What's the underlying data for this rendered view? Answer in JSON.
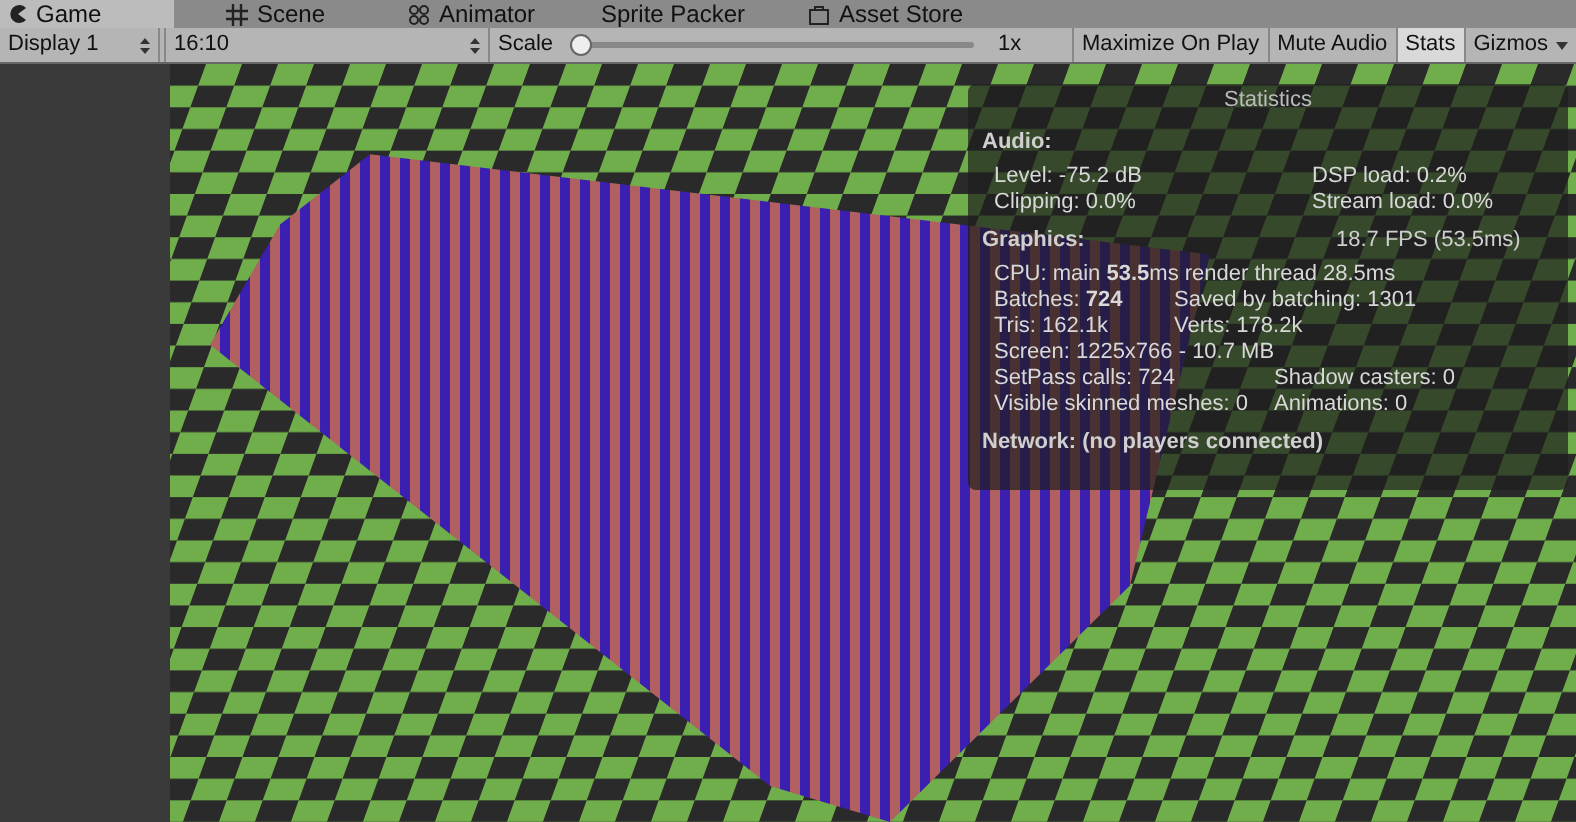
{
  "tabs": [
    {
      "label": "Game",
      "selected": true
    },
    {
      "label": "Scene",
      "selected": false
    },
    {
      "label": "Animator",
      "selected": false
    },
    {
      "label": "Sprite Packer",
      "selected": false
    },
    {
      "label": "Asset Store",
      "selected": false
    }
  ],
  "toolbar": {
    "display": "Display 1",
    "aspect": "16:10",
    "scale": {
      "label": "Scale",
      "level": 0,
      "reading": "1x"
    },
    "buttons": [
      {
        "kind": "toggle",
        "label": "Maximize On Play",
        "on": false
      },
      {
        "kind": "toggle",
        "label": "Mute Audio",
        "on": false
      },
      {
        "kind": "toggle",
        "label": "Stats",
        "on": true
      },
      {
        "kind": "dropdown",
        "label": "Gizmos"
      }
    ]
  },
  "statistics": {
    "title": "Statistics",
    "sections": [
      {
        "heading": "Audio:",
        "rows": [
          {
            "kind": "split",
            "left": "Level: -75.2 dB",
            "right": "DSP load: 0.2%"
          },
          {
            "kind": "split",
            "left": "Clipping: 0.0%",
            "right": "Stream load: 0.0%"
          }
        ]
      },
      {
        "heading": "Graphics:",
        "heading_right": "18.7 FPS (53.5ms)",
        "rows": [
          {
            "kind": "single",
            "left": "CPU: main **53.5**ms  render thread 28.5ms"
          },
          {
            "kind": "short",
            "left": "Batches: **724**",
            "right": "Saved by batching: 1301"
          },
          {
            "kind": "short",
            "left": "Tris: 162.1k",
            "right": "Verts: 178.2k"
          },
          {
            "kind": "single",
            "left": "Screen: 1225x766 - 10.7 MB"
          },
          {
            "kind": "long",
            "left": "SetPass calls: 724",
            "right": "Shadow casters: 0"
          },
          {
            "kind": "long",
            "left": "Visible skinned meshes: 0",
            "right": "Animations: 0"
          }
        ]
      },
      {
        "heading": "Network: (no players connected)"
      }
    ]
  }
}
